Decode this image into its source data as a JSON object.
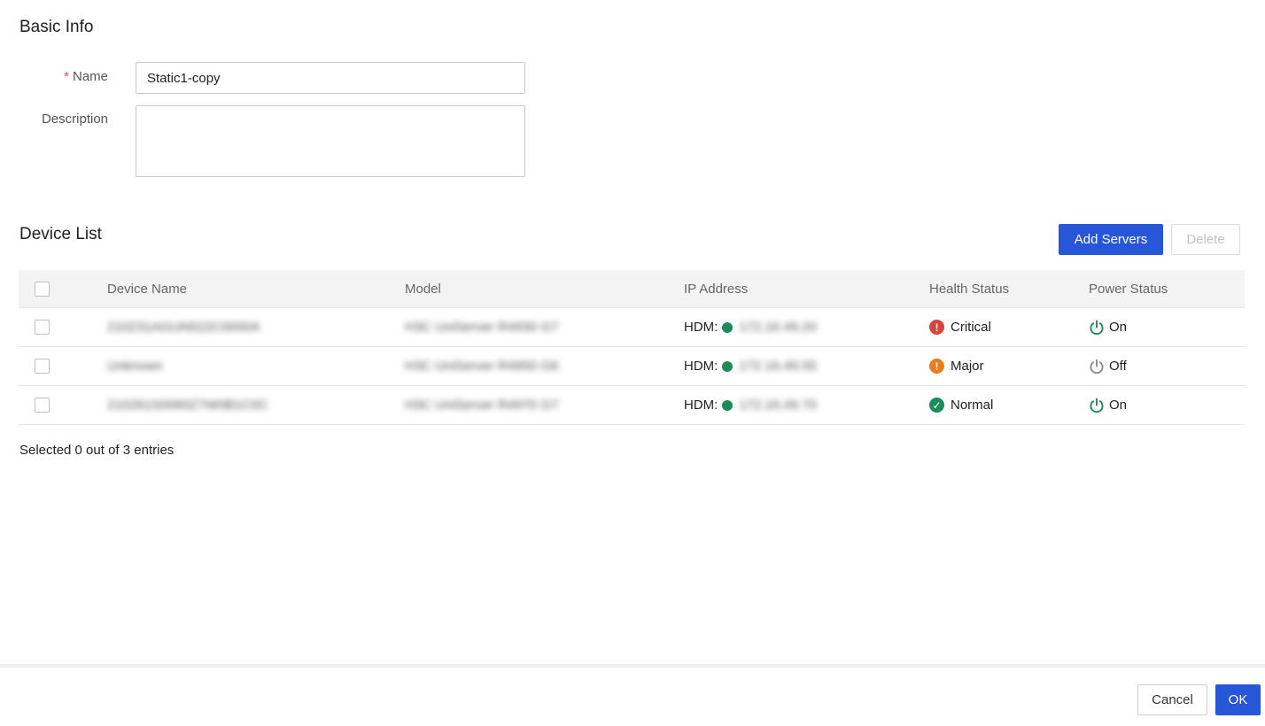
{
  "basic_info": {
    "title": "Basic Info",
    "name_required_mark": "*",
    "name_label": "Name",
    "name_value": "Static1-copy",
    "description_label": "Description",
    "description_value": ""
  },
  "device_list": {
    "title": "Device List",
    "add_servers_label": "Add Servers",
    "delete_label": "Delete",
    "columns": [
      "Device Name",
      "Model",
      "IP Address",
      "Health Status",
      "Power Status"
    ],
    "rows": [
      {
        "device_name": "210231AGUN522C0000A",
        "model": "H3C UniServer R4930 G7",
        "ip_prefix": "HDM:",
        "ip": "172.16.49.20",
        "health": "Critical",
        "health_color": "#d9443a",
        "health_icon": "exclamation-icon",
        "power": "On",
        "power_color": "#1d8a5b"
      },
      {
        "device_name": "Unknown",
        "model": "H3C UniServer R4950 G6",
        "ip_prefix": "HDM:",
        "ip": "172.16.49.55",
        "health": "Major",
        "health_color": "#e67e22",
        "health_icon": "exclamation-icon",
        "power": "Off",
        "power_color": "#8c8c8c"
      },
      {
        "device_name": "210261S0060Z7W0B1C0C",
        "model": "H3C UniServer R4970 G7",
        "ip_prefix": "HDM:",
        "ip": "172.16.49.70",
        "health": "Normal",
        "health_color": "#1d8a5b",
        "health_icon": "check-icon",
        "power": "On",
        "power_color": "#1d8a5b"
      }
    ],
    "selection_summary": "Selected 0 out of 3 entries"
  },
  "footer": {
    "cancel_label": "Cancel",
    "ok_label": "OK"
  },
  "colors": {
    "primary": "#2756d8",
    "ip_online": "#1d8a5b"
  }
}
